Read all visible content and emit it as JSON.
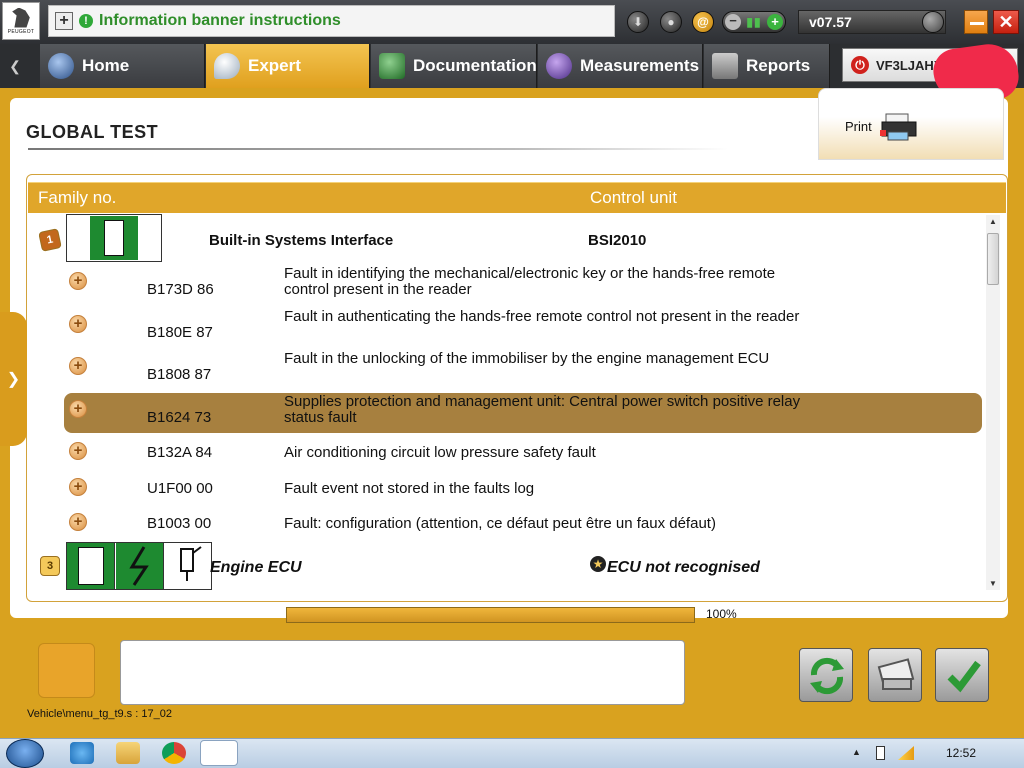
{
  "topbar": {
    "banner_text": "Information banner instructions",
    "version": "v07.57",
    "logo_text": "PEUGEOT"
  },
  "nav": {
    "tabs": [
      {
        "label": "Home",
        "active": false
      },
      {
        "label": "Expert",
        "active": true
      },
      {
        "label": "Documentation",
        "active": false
      },
      {
        "label": "Measurements",
        "active": false
      },
      {
        "label": "Reports",
        "active": false
      }
    ],
    "vin": "VF3LJAHXH"
  },
  "page": {
    "title": "GLOBAL TEST",
    "print_label": "Print"
  },
  "table": {
    "headers": {
      "family": "Family no.",
      "control_unit": "Control unit"
    },
    "groups": [
      {
        "badge": "1",
        "name": "Built-in Systems Interface",
        "control_unit": "BSI2010",
        "faults": [
          {
            "code": "B173D 86",
            "description": "Fault in identifying the mechanical/electronic key or the hands-free remote control present in the reader",
            "highlighted": false
          },
          {
            "code": "B180E 87",
            "description": "Fault in authenticating the hands-free remote control not present in the reader",
            "highlighted": false
          },
          {
            "code": "B1808 87",
            "description": "Fault in the unlocking of the immobiliser by the engine management ECU",
            "highlighted": false
          },
          {
            "code": "B1624 73",
            "description": "Supplies protection and management unit: Central power switch positive relay status fault",
            "highlighted": true
          },
          {
            "code": "B132A 84",
            "description": "Air conditioning circuit low pressure safety fault",
            "highlighted": false
          },
          {
            "code": "U1F00 00",
            "description": "Fault event not stored in the faults log",
            "highlighted": false
          },
          {
            "code": "B1003 00",
            "description": "Fault: configuration (attention, ce défaut peut être un faux défaut)",
            "highlighted": false
          }
        ]
      },
      {
        "badge": "3",
        "name": "Engine ECU",
        "control_unit": "ECU not recognised"
      }
    ]
  },
  "progress": {
    "value": 1.0,
    "label": "100%"
  },
  "status": {
    "path": "Vehicle\\menu_tg_t9.s : 17_02"
  },
  "taskbar": {
    "clock": "12:52"
  },
  "colors": {
    "accent": "#e0a62a",
    "highlight_row": "#a7803f",
    "banner_text": "#2f8e2a",
    "icon_green": "#1e8a30"
  }
}
